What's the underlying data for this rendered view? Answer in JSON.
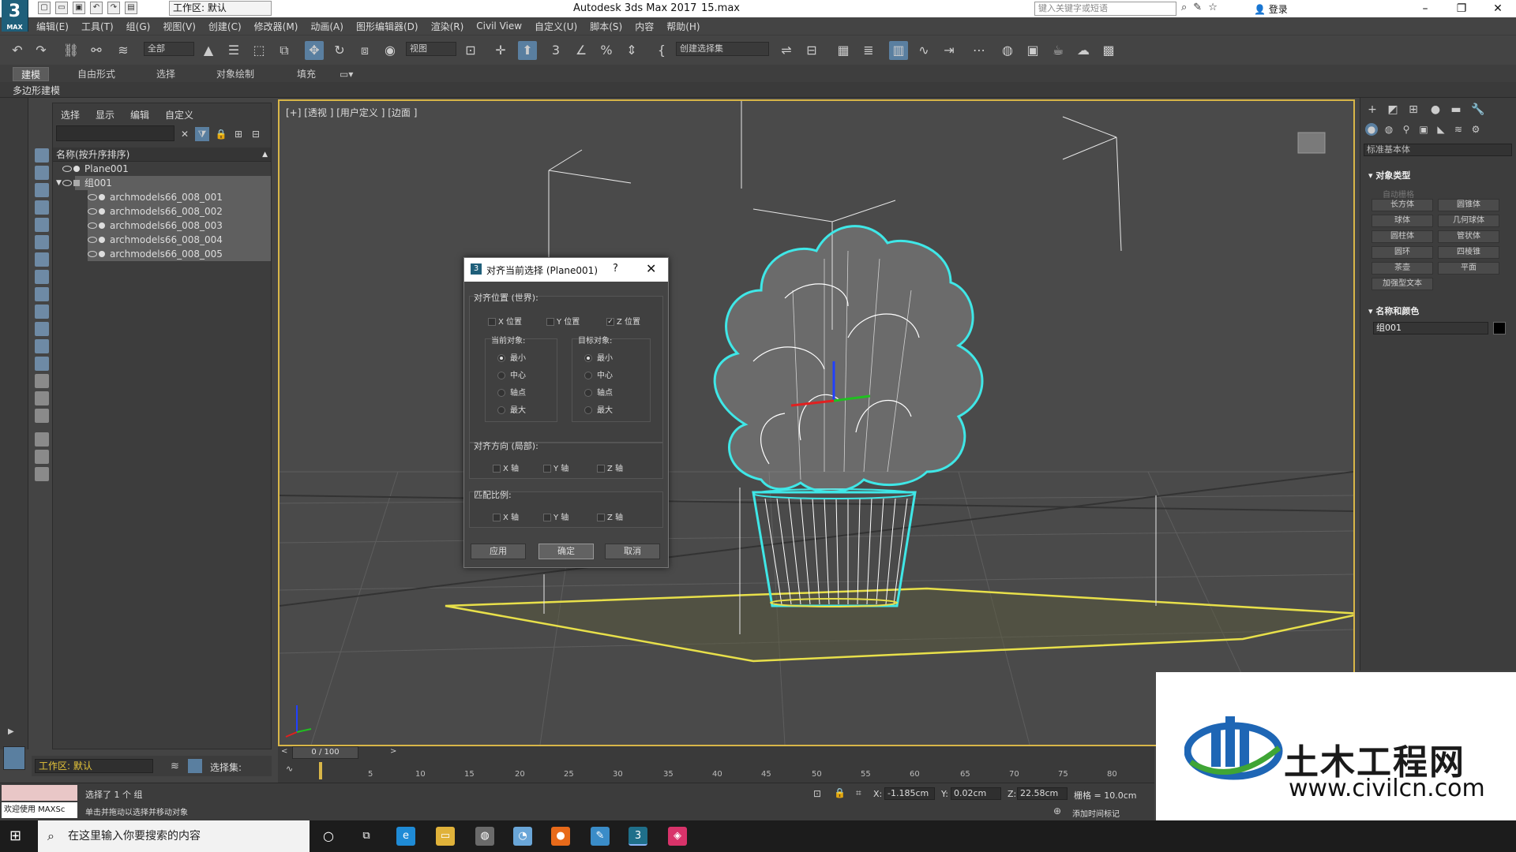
{
  "titlebar": {
    "logo": "3",
    "logo_sub": "MAX",
    "workspace": "工作区: 默认",
    "app_title": "Autodesk 3ds Max 2017",
    "file_name": "15.max",
    "search_placeholder": "键入关键字或短语",
    "login": "登录"
  },
  "menu": [
    "编辑(E)",
    "工具(T)",
    "组(G)",
    "视图(V)",
    "创建(C)",
    "修改器(M)",
    "动画(A)",
    "图形编辑器(D)",
    "渲染(R)",
    "Civil View",
    "自定义(U)",
    "脚本(S)",
    "内容",
    "帮助(H)"
  ],
  "toolbar": {
    "selection_filter": "全部",
    "ref_coord": "视图",
    "named_selection": "创建选择集"
  },
  "ribbon": {
    "tabs": [
      "建模",
      "自由形式",
      "选择",
      "对象绘制",
      "填充"
    ],
    "active_tab": "建模",
    "sub_label": "多边形建模"
  },
  "explorer": {
    "menu": [
      "选择",
      "显示",
      "编辑",
      "自定义"
    ],
    "header": "名称(按升序排序)",
    "items": [
      {
        "name": "Plane001",
        "level": 0,
        "selected": false
      },
      {
        "name": "组001",
        "level": 0,
        "selected": true
      },
      {
        "name": "archmodels66_008_001",
        "level": 1,
        "selected": true
      },
      {
        "name": "archmodels66_008_002",
        "level": 1,
        "selected": true
      },
      {
        "name": "archmodels66_008_003",
        "level": 1,
        "selected": true
      },
      {
        "name": "archmodels66_008_004",
        "level": 1,
        "selected": true
      },
      {
        "name": "archmodels66_008_005",
        "level": 1,
        "selected": true
      }
    ],
    "workspace": "工作区: 默认",
    "selection_set": "选择集:"
  },
  "viewport": {
    "label": "[+] [透视 ] [用户定义 ] [边面 ]"
  },
  "dialog": {
    "title": "对齐当前选择 (Plane001)",
    "help": "?",
    "align_position_label": "对齐位置 (世界):",
    "x_pos": "X 位置",
    "y_pos": "Y 位置",
    "z_pos": "Z 位置",
    "x_pos_checked": false,
    "y_pos_checked": false,
    "z_pos_checked": true,
    "current_object_label": "当前对象:",
    "target_object_label": "目标对象:",
    "options": [
      "最小",
      "中心",
      "轴点",
      "最大"
    ],
    "current_selected": "最小",
    "target_selected": "最小",
    "align_orientation_label": "对齐方向 (局部):",
    "match_scale_label": "匹配比例:",
    "x_axis": "X 轴",
    "y_axis": "Y 轴",
    "z_axis": "Z 轴",
    "apply": "应用",
    "ok": "确定",
    "cancel": "取消"
  },
  "command_panel": {
    "dropdown": "标准基本体",
    "object_type_label": "对象类型",
    "autogrid": "自动栅格",
    "primitives": [
      "长方体",
      "圆锥体",
      "球体",
      "几何球体",
      "圆柱体",
      "管状体",
      "圆环",
      "四棱锥",
      "茶壶",
      "平面",
      "加强型文本"
    ],
    "name_color_label": "名称和颜色",
    "name_value": "组001",
    "object_color": "#000000"
  },
  "timeline": {
    "frame_display": "0 / 100",
    "ticks": [
      "5",
      "10",
      "15",
      "20",
      "25",
      "30",
      "35",
      "40",
      "45",
      "50",
      "55",
      "60",
      "65",
      "70",
      "75",
      "80"
    ]
  },
  "status": {
    "welcome": "欢迎使用 MAXSc",
    "line1": "选择了 1 个 组",
    "line2": "单击并拖动以选择并移动对象",
    "x_label": "X:",
    "x_val": "-1.185cm",
    "y_label": "Y:",
    "y_val": "0.02cm",
    "z_label": "Z:",
    "z_val": "22.58cm",
    "grid": "栅格 = 10.0cm",
    "add_time_tag": "添加时间标记"
  },
  "watermark": {
    "title": "土木工程网",
    "url": "www.civilcn.com"
  },
  "taskbar": {
    "search": "在这里输入你要搜索的内容"
  },
  "colors": {
    "viewport_border": "#d8b648",
    "wire_cyan": "#3fe7e7",
    "plane_yellow": "#e8e04a",
    "selection_row": "#5f5f5f"
  }
}
